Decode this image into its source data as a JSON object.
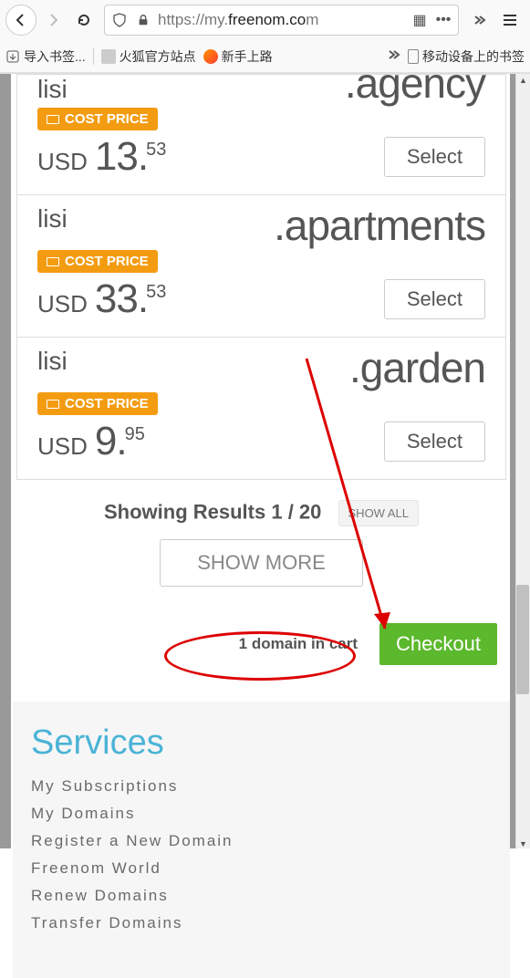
{
  "browser": {
    "url_prefix": "https://my.",
    "url_bold": "freenom.co",
    "url_suffix": "m",
    "bookmarks": [
      {
        "id": "import",
        "label": "导入书签..."
      },
      {
        "id": "official",
        "label": "火狐官方站点"
      },
      {
        "id": "newbie",
        "label": "新手上路"
      }
    ],
    "mobile_bookmark": "移动设备上的书签"
  },
  "domains": [
    {
      "name": "lisi",
      "tld": ".agency",
      "badge": "COST PRICE",
      "currency": "USD",
      "whole": "13.",
      "cents": "53",
      "select": "Select"
    },
    {
      "name": "lisi",
      "tld": ".apartments",
      "badge": "COST PRICE",
      "currency": "USD",
      "whole": "33.",
      "cents": "53",
      "select": "Select"
    },
    {
      "name": "lisi",
      "tld": ".garden",
      "badge": "COST PRICE",
      "currency": "USD",
      "whole": "9.",
      "cents": "95",
      "select": "Select"
    }
  ],
  "results": {
    "showing": "Showing Results 1 / 20",
    "showall": "SHOW ALL",
    "showmore": "SHOW MORE"
  },
  "cart": {
    "text": "1 domain in cart",
    "checkout": "Checkout"
  },
  "footer": {
    "heading": "Services",
    "links": [
      "My Subscriptions",
      "My Domains",
      "Register a New Domain",
      "Freenom World",
      "Renew Domains",
      "Transfer Domains"
    ]
  }
}
